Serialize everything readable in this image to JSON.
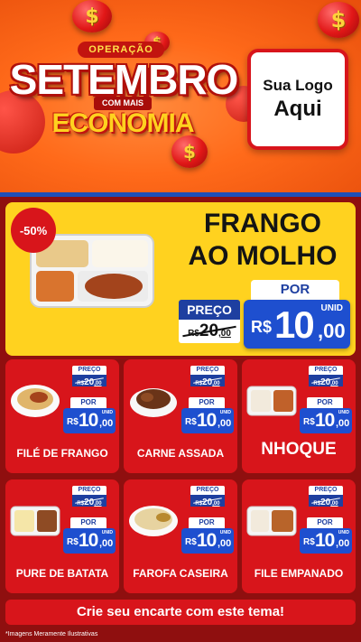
{
  "hero": {
    "operation_label": "OPERAÇÃO",
    "title": "SETEMBRO",
    "connector": "COM MAIS",
    "subtitle": "ECONOMIA",
    "coin_symbol": "$",
    "logo_line1": "Sua Logo",
    "logo_line2": "Aqui",
    "colors": {
      "orange": "#ff6a1a",
      "red": "#d8151b",
      "yellow": "#ffd21f",
      "blue": "#1e4fcf"
    }
  },
  "featured": {
    "discount": "-50%",
    "name_line1": "FRANGO",
    "name_line2": "AO MOLHO",
    "preco_label": "PREÇO",
    "old_currency": "R$",
    "old_int": "20",
    "old_cents": ",00",
    "por_label": "POR",
    "unid_label": "UNID",
    "new_currency": "R$",
    "new_int": "10",
    "new_cents": ",00"
  },
  "products": [
    {
      "name": "FILÉ DE FRANGO",
      "preco_label": "PREÇO",
      "old_currency": "R$",
      "old_int": "20",
      "old_cents": ",00",
      "por_label": "POR",
      "unid_label": "UNID",
      "new_currency": "R$",
      "new_int": "10",
      "new_cents": ",00",
      "icon": "bowl-dish-icon"
    },
    {
      "name": "CARNE ASSADA",
      "preco_label": "PREÇO",
      "old_currency": "R$",
      "old_int": "20",
      "old_cents": ",00",
      "por_label": "POR",
      "unid_label": "UNID",
      "new_currency": "R$",
      "new_int": "10",
      "new_cents": ",00",
      "icon": "bowl-dish-icon"
    },
    {
      "name": "NHOQUE",
      "preco_label": "PREÇO",
      "old_currency": "R$",
      "old_int": "20",
      "old_cents": ",00",
      "por_label": "POR",
      "unid_label": "UNID",
      "new_currency": "R$",
      "new_int": "10",
      "new_cents": ",00",
      "icon": "tray-dish-icon"
    },
    {
      "name": "PURE DE BATATA",
      "preco_label": "PREÇO",
      "old_currency": "R$",
      "old_int": "20",
      "old_cents": ",00",
      "por_label": "POR",
      "unid_label": "UNID",
      "new_currency": "R$",
      "new_int": "10",
      "new_cents": ",00",
      "icon": "tray-dish-icon"
    },
    {
      "name": "FAROFA CASEIRA",
      "preco_label": "PREÇO",
      "old_currency": "R$",
      "old_int": "20",
      "old_cents": ",00",
      "por_label": "POR",
      "unid_label": "UNID",
      "new_currency": "R$",
      "new_int": "10",
      "new_cents": ",00",
      "icon": "bowl-dish-icon"
    },
    {
      "name": "FILE EMPANADO",
      "preco_label": "PREÇO",
      "old_currency": "R$",
      "old_int": "20",
      "old_cents": ",00",
      "por_label": "POR",
      "unid_label": "UNID",
      "new_currency": "R$",
      "new_int": "10",
      "new_cents": ",00",
      "icon": "tray-dish-icon"
    }
  ],
  "cta": {
    "label": "Crie seu encarte com este tema!"
  },
  "footer": {
    "disclaimer": "*Imagens Meramente Ilustrativas"
  }
}
